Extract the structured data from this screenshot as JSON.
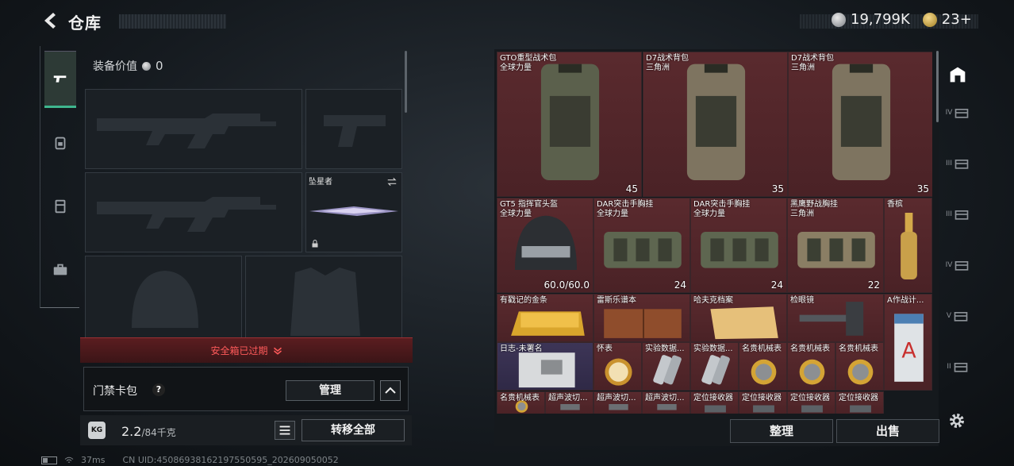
{
  "header": {
    "title": "仓库",
    "silver": "19,799K",
    "gold": "23+"
  },
  "equipment": {
    "value_label": "装备价值",
    "value": "0",
    "knife_label": "坠星者",
    "safe_box_expired": "安全箱已过期"
  },
  "card_pack": {
    "label": "门禁卡包",
    "help": "?",
    "manage": "管理"
  },
  "capacity": {
    "lock": "KG",
    "current": "2.2",
    "max": "/84千克",
    "transfer_all": "转移全部"
  },
  "items": [
    {
      "name": "GTO重型战术包",
      "sub": "全球力量",
      "note": "45",
      "color": "red"
    },
    {
      "name": "D7战术背包",
      "sub": "三角洲",
      "note": "35",
      "color": "red"
    },
    {
      "name": "D7战术背包",
      "sub": "三角洲",
      "note": "35",
      "color": "red"
    },
    {
      "name": "GT5 指挥官头盔",
      "sub": "全球力量",
      "note": "60.0/60.0",
      "color": "red"
    },
    {
      "name": "DAR突击手胸挂",
      "sub": "全球力量",
      "note": "24",
      "color": "red"
    },
    {
      "name": "DAR突击手胸挂",
      "sub": "全球力量",
      "note": "24",
      "color": "red"
    },
    {
      "name": "黑鹰野战胸挂",
      "sub": "三角洲",
      "note": "22",
      "color": "red"
    },
    {
      "name": "香槟",
      "sub": "",
      "note": "",
      "color": "red"
    },
    {
      "name": "有戳记的金条",
      "sub": "",
      "note": "",
      "color": "red"
    },
    {
      "name": "雷斯乐谱本",
      "sub": "",
      "note": "",
      "color": "red"
    },
    {
      "name": "哈夫克档案",
      "sub": "",
      "note": "",
      "color": "red"
    },
    {
      "name": "检眼镜",
      "sub": "",
      "note": "",
      "color": "red"
    },
    {
      "name": "A作战计...",
      "sub": "",
      "note": "",
      "color": "red"
    },
    {
      "name": "日志-未署名",
      "sub": "",
      "note": "",
      "color": "purple"
    },
    {
      "name": "怀表",
      "sub": "",
      "note": "",
      "color": "red"
    },
    {
      "name": "实验数据...",
      "sub": "",
      "note": "",
      "color": "red"
    },
    {
      "name": "实验数据...",
      "sub": "",
      "note": "",
      "color": "red"
    },
    {
      "name": "名贵机械表",
      "sub": "",
      "note": "",
      "color": "red"
    },
    {
      "name": "名贵机械表",
      "sub": "",
      "note": "",
      "color": "red"
    },
    {
      "name": "名贵机械表",
      "sub": "",
      "note": "",
      "color": "red"
    },
    {
      "name": "名贵机械表",
      "sub": "",
      "note": "",
      "color": "red"
    },
    {
      "name": "超声波切...",
      "sub": "",
      "note": "",
      "color": "red"
    },
    {
      "name": "超声波切...",
      "sub": "",
      "note": "",
      "color": "red"
    },
    {
      "name": "超声波切...",
      "sub": "",
      "note": "",
      "color": "red"
    },
    {
      "name": "定位接收器",
      "sub": "",
      "note": "",
      "color": "red"
    },
    {
      "name": "定位接收器",
      "sub": "",
      "note": "",
      "color": "red"
    },
    {
      "name": "定位接收器",
      "sub": "",
      "note": "",
      "color": "red"
    },
    {
      "name": "定位接收器",
      "sub": "",
      "note": "",
      "color": "red"
    }
  ],
  "actions": {
    "sort": "整理",
    "sell": "出售"
  },
  "right_tabs": [
    "I",
    "IV",
    "III",
    "III",
    "IV",
    "V",
    "II"
  ],
  "footer": {
    "ping": "37ms",
    "uid": "CN UID:45086938162197550595_202609050052"
  }
}
